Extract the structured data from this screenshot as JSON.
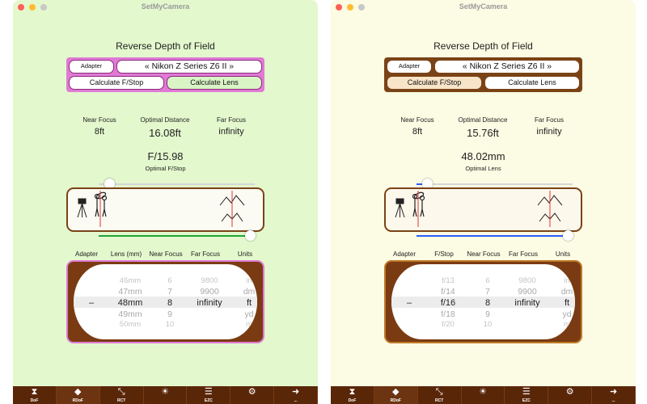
{
  "windows": [
    {
      "title": "SetMyCamera",
      "heading": "Reverse Depth of Field",
      "adapter_label": "Adapter",
      "camera": "« Nikon Z Series Z6 II »",
      "calc_fstop_label": "Calculate F/Stop",
      "calc_lens_label": "Calculate Lens",
      "near_focus_label": "Near Focus",
      "optimal_distance_label": "Optimal Distance",
      "far_focus_label": "Far Focus",
      "near_focus_value": "8ft",
      "optimal_distance_value": "16.08ft",
      "far_focus_value": "infinity",
      "result_value": "F/15.98",
      "result_label": "Optimal F/Stop",
      "slider_top_value": 0.07,
      "slider_bottom_value": 0.97,
      "columns": [
        "Adapter",
        "Lens (mm)",
        "Near Focus",
        "Far Focus",
        "Units"
      ],
      "rows": [
        [
          "",
          "46mm",
          "6",
          "9800",
          "in"
        ],
        [
          "",
          "47mm",
          "7",
          "9900",
          "dm"
        ],
        [
          "–",
          "48mm",
          "8",
          "infinity",
          "ft"
        ],
        [
          "",
          "49mm",
          "9",
          "",
          "yd"
        ],
        [
          "",
          "50mm",
          "10",
          "",
          "m"
        ]
      ]
    },
    {
      "title": "SetMyCamera",
      "heading": "Reverse Depth of Field",
      "adapter_label": "Adapter",
      "camera": "« Nikon Z Series Z6 II »",
      "calc_fstop_label": "Calculate F/Stop",
      "calc_lens_label": "Calculate Lens",
      "near_focus_label": "Near Focus",
      "optimal_distance_label": "Optimal Distance",
      "far_focus_label": "Far Focus",
      "near_focus_value": "8ft",
      "optimal_distance_value": "15.76ft",
      "far_focus_value": "infinity",
      "result_value": "48.02mm",
      "result_label": "Optimal Lens",
      "slider_top_value": 0.07,
      "slider_bottom_value": 0.97,
      "columns": [
        "Adapter",
        "F/Stop",
        "Near Focus",
        "Far Focus",
        "Units"
      ],
      "rows": [
        [
          "",
          "f/13",
          "6",
          "9800",
          "in"
        ],
        [
          "",
          "f/14",
          "7",
          "9900",
          "dm"
        ],
        [
          "–",
          "f/16",
          "8",
          "infinity",
          "ft"
        ],
        [
          "",
          "f/18",
          "9",
          "",
          "yd"
        ],
        [
          "",
          "f/20",
          "10",
          "",
          "m"
        ]
      ]
    }
  ],
  "toolbar": [
    {
      "label": "DoF",
      "icon": "dof-icon"
    },
    {
      "label": "RDoF",
      "icon": "rdof-icon"
    },
    {
      "label": "RCT",
      "icon": "rct-icon"
    },
    {
      "label": "",
      "icon": "lightbulb-icon"
    },
    {
      "label": "EZC",
      "icon": "ezc-icon"
    },
    {
      "label": "",
      "icon": "gear-icon"
    },
    {
      "label": "...",
      "icon": "arrow-right-icon"
    }
  ],
  "colors": {
    "left_background": "#e3f8cd",
    "right_background": "#fcfbe3",
    "left_accent": "#e07ad4",
    "right_accent": "#7a4316",
    "toolbar": "#5a2608",
    "slider_active": "#2b5cff"
  }
}
